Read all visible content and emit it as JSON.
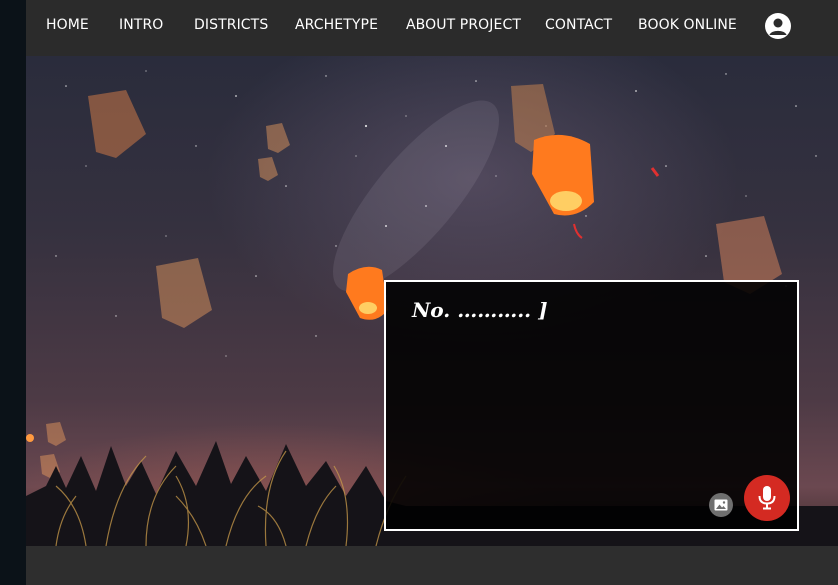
{
  "nav": {
    "items": [
      {
        "label": "HOME"
      },
      {
        "label": "INTRO"
      },
      {
        "label": "DISTRICTS"
      },
      {
        "label": "ARCHETYPE"
      },
      {
        "label": "ABOUT PROJECT"
      },
      {
        "label": "CONTACT"
      },
      {
        "label": "BOOK ONLINE"
      }
    ],
    "account_icon": "user-account-icon"
  },
  "prompt": {
    "text": "No. ……….. ]",
    "image_icon": "image-icon",
    "mic_icon": "microphone-icon"
  },
  "colors": {
    "nav_bg": "#2b2b2b",
    "mic_red": "#d42a22",
    "lantern_orange": "#ff8a2a"
  }
}
